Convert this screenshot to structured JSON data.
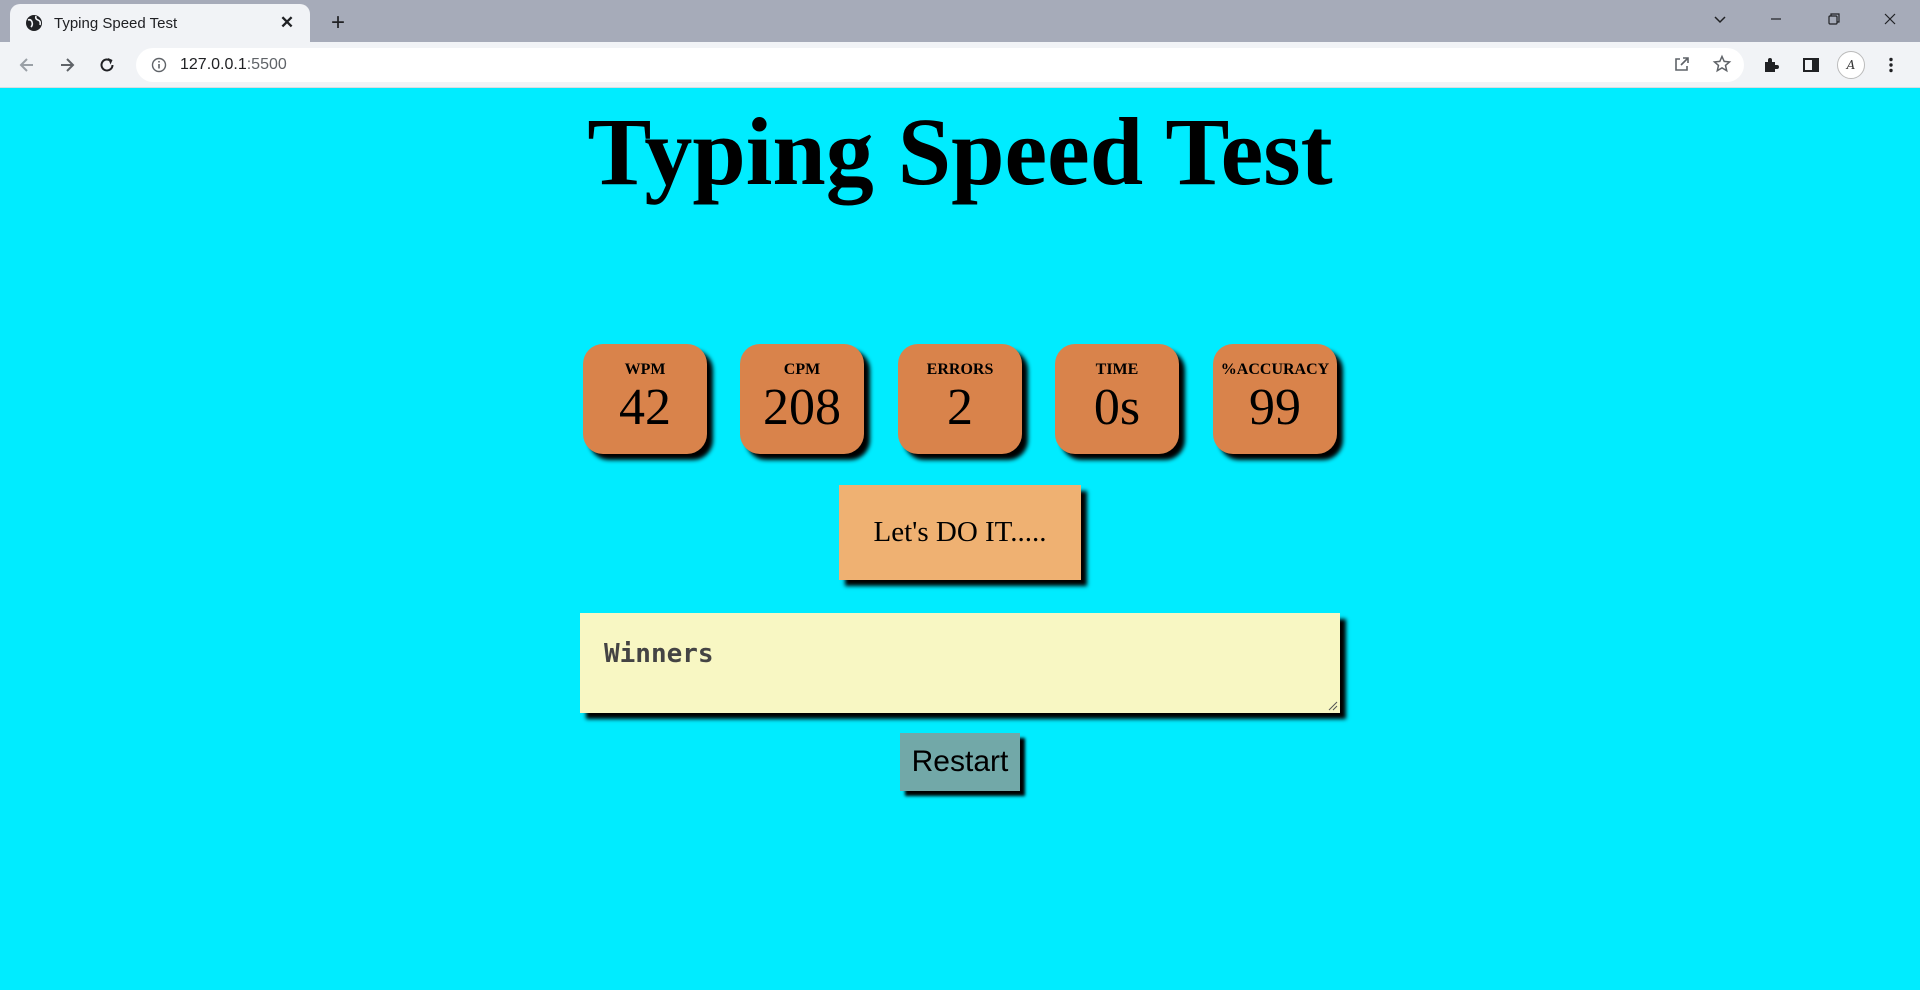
{
  "browser": {
    "tab_title": "Typing Speed Test",
    "new_tab_label": "+",
    "url_host": "127.0.0.1",
    "url_port": ":5500"
  },
  "page": {
    "title": "Typing Speed Test",
    "stats": [
      {
        "label": "WPM",
        "value": "42"
      },
      {
        "label": "CPM",
        "value": "208"
      },
      {
        "label": "ERRORS",
        "value": "2"
      },
      {
        "label": "TIME",
        "value": "0s"
      },
      {
        "label": "%ACCURACY",
        "value": "99"
      }
    ],
    "quote_text": "Let's DO IT.....",
    "input_value": "Winners",
    "restart_label": "Restart"
  },
  "colors": {
    "page_background": "#00ecff",
    "stat_card": "#d9834b",
    "quote_box": "#efb172",
    "input_background": "#f8f7c3",
    "restart_button": "#72a8a8"
  }
}
